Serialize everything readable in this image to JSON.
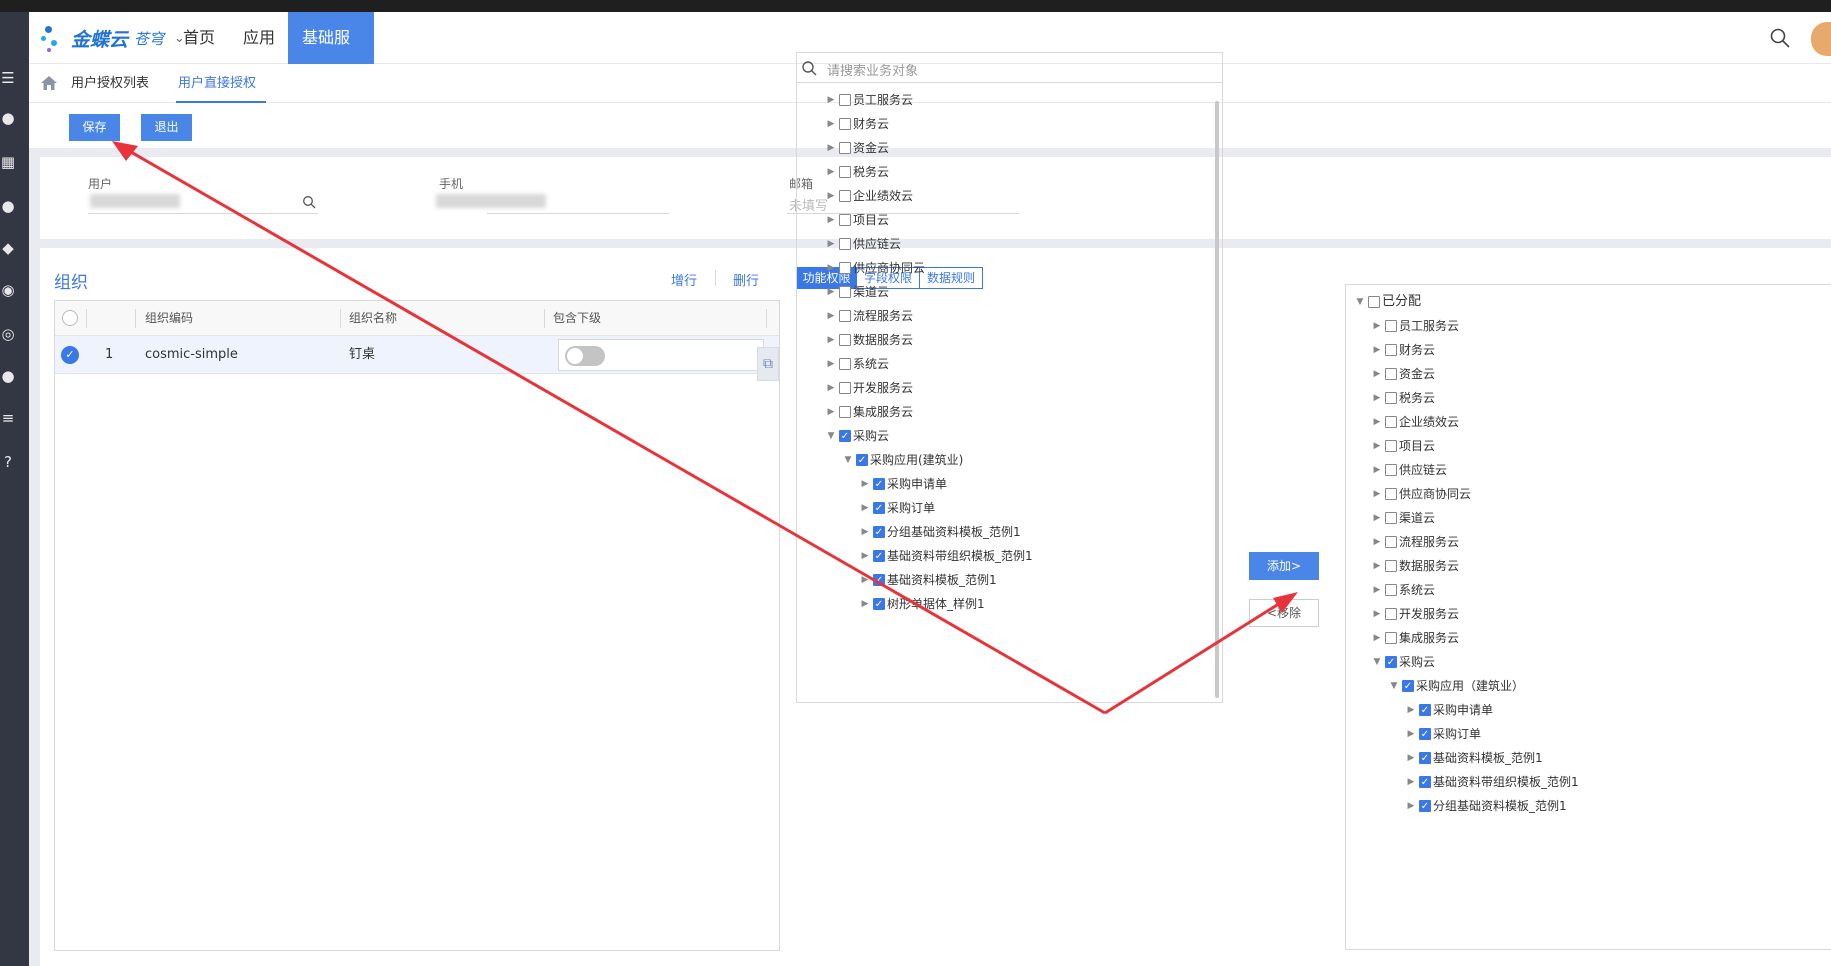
{
  "topbar": {
    "brand": "金蝶云",
    "brand_sub": "苍穹",
    "nav": [
      {
        "label": "首页",
        "active": false
      },
      {
        "label": "应用",
        "active": false
      },
      {
        "label": "基础服务",
        "active": true
      }
    ]
  },
  "tabs": [
    {
      "label": "用户授权列表",
      "active": false
    },
    {
      "label": "用户直接授权",
      "active": true
    }
  ],
  "toolbar": {
    "save_label": "保存",
    "exit_label": "退出"
  },
  "user_info": {
    "user_label": "用户",
    "phone_label": "手机",
    "email_label": "邮箱",
    "email_placeholder": "未填写"
  },
  "org": {
    "title": "组织",
    "add_row": "增行",
    "delete_row": "删行",
    "columns": [
      "组织编码",
      "组织名称",
      "包含下级"
    ],
    "rows": [
      {
        "index": "1",
        "code": "cosmic-simple",
        "name": "钉桌",
        "include_sub": false,
        "selected": true
      }
    ]
  },
  "perm_tabs": [
    {
      "label": "功能权限",
      "active": true
    },
    {
      "label": "字段权限",
      "active": false
    },
    {
      "label": "数据规则",
      "active": false
    }
  ],
  "tree": {
    "search_placeholder": "请搜索业务对象",
    "nodes": [
      {
        "label": "员工服务云",
        "level": 0,
        "expanded": false,
        "checked": false
      },
      {
        "label": "财务云",
        "level": 0,
        "expanded": false,
        "checked": false
      },
      {
        "label": "资金云",
        "level": 0,
        "expanded": false,
        "checked": false
      },
      {
        "label": "税务云",
        "level": 0,
        "expanded": false,
        "checked": false
      },
      {
        "label": "企业绩效云",
        "level": 0,
        "expanded": false,
        "checked": false
      },
      {
        "label": "项目云",
        "level": 0,
        "expanded": false,
        "checked": false
      },
      {
        "label": "供应链云",
        "level": 0,
        "expanded": false,
        "checked": false
      },
      {
        "label": "供应商协同云",
        "level": 0,
        "expanded": false,
        "checked": false
      },
      {
        "label": "渠道云",
        "level": 0,
        "expanded": false,
        "checked": false
      },
      {
        "label": "流程服务云",
        "level": 0,
        "expanded": false,
        "checked": false
      },
      {
        "label": "数据服务云",
        "level": 0,
        "expanded": false,
        "checked": false
      },
      {
        "label": "系统云",
        "level": 0,
        "expanded": false,
        "checked": false
      },
      {
        "label": "开发服务云",
        "level": 0,
        "expanded": false,
        "checked": false
      },
      {
        "label": "集成服务云",
        "level": 0,
        "expanded": false,
        "checked": false
      },
      {
        "label": "采购云",
        "level": 0,
        "expanded": true,
        "checked": true
      },
      {
        "label": "采购应用(建筑业)",
        "level": 1,
        "expanded": true,
        "checked": true
      },
      {
        "label": "采购申请单",
        "level": 2,
        "expanded": false,
        "checked": true
      },
      {
        "label": "采购订单",
        "level": 2,
        "expanded": false,
        "checked": true
      },
      {
        "label": "分组基础资料模板_范例1",
        "level": 2,
        "expanded": false,
        "checked": true
      },
      {
        "label": "基础资料带组织模板_范例1",
        "level": 2,
        "expanded": false,
        "checked": true
      },
      {
        "label": "基础资料模板_范例1",
        "level": 2,
        "expanded": false,
        "checked": true
      },
      {
        "label": "树形单据体_样例1",
        "level": 2,
        "expanded": false,
        "checked": true
      }
    ]
  },
  "transfer": {
    "add_label": "添加>",
    "remove_label": "<移除"
  },
  "assigned": {
    "root_label": "已分配",
    "nodes": [
      {
        "label": "员工服务云",
        "level": 1,
        "expanded": false,
        "checked": false
      },
      {
        "label": "财务云",
        "level": 1,
        "expanded": false,
        "checked": false
      },
      {
        "label": "资金云",
        "level": 1,
        "expanded": false,
        "checked": false
      },
      {
        "label": "税务云",
        "level": 1,
        "expanded": false,
        "checked": false
      },
      {
        "label": "企业绩效云",
        "level": 1,
        "expanded": false,
        "checked": false
      },
      {
        "label": "项目云",
        "level": 1,
        "expanded": false,
        "checked": false
      },
      {
        "label": "供应链云",
        "level": 1,
        "expanded": false,
        "checked": false
      },
      {
        "label": "供应商协同云",
        "level": 1,
        "expanded": false,
        "checked": false
      },
      {
        "label": "渠道云",
        "level": 1,
        "expanded": false,
        "checked": false
      },
      {
        "label": "流程服务云",
        "level": 1,
        "expanded": false,
        "checked": false
      },
      {
        "label": "数据服务云",
        "level": 1,
        "expanded": false,
        "checked": false
      },
      {
        "label": "系统云",
        "level": 1,
        "expanded": false,
        "checked": false
      },
      {
        "label": "开发服务云",
        "level": 1,
        "expanded": false,
        "checked": false
      },
      {
        "label": "集成服务云",
        "level": 1,
        "expanded": false,
        "checked": false
      },
      {
        "label": "采购云",
        "level": 1,
        "expanded": true,
        "checked": true
      },
      {
        "label": "采购应用（建筑业）",
        "level": 2,
        "expanded": true,
        "checked": true
      },
      {
        "label": "采购申请单",
        "level": 3,
        "expanded": false,
        "checked": true
      },
      {
        "label": "采购订单",
        "level": 3,
        "expanded": false,
        "checked": true
      },
      {
        "label": "基础资料模板_范例1",
        "level": 3,
        "expanded": false,
        "checked": true
      },
      {
        "label": "基础资料带组织模板_范例1",
        "level": 3,
        "expanded": false,
        "checked": true
      },
      {
        "label": "分组基础资料模板_范例1",
        "level": 3,
        "expanded": false,
        "checked": true
      }
    ]
  },
  "colors": {
    "accent": "#3b78e7",
    "annotation_arrow": "#e8333a"
  }
}
